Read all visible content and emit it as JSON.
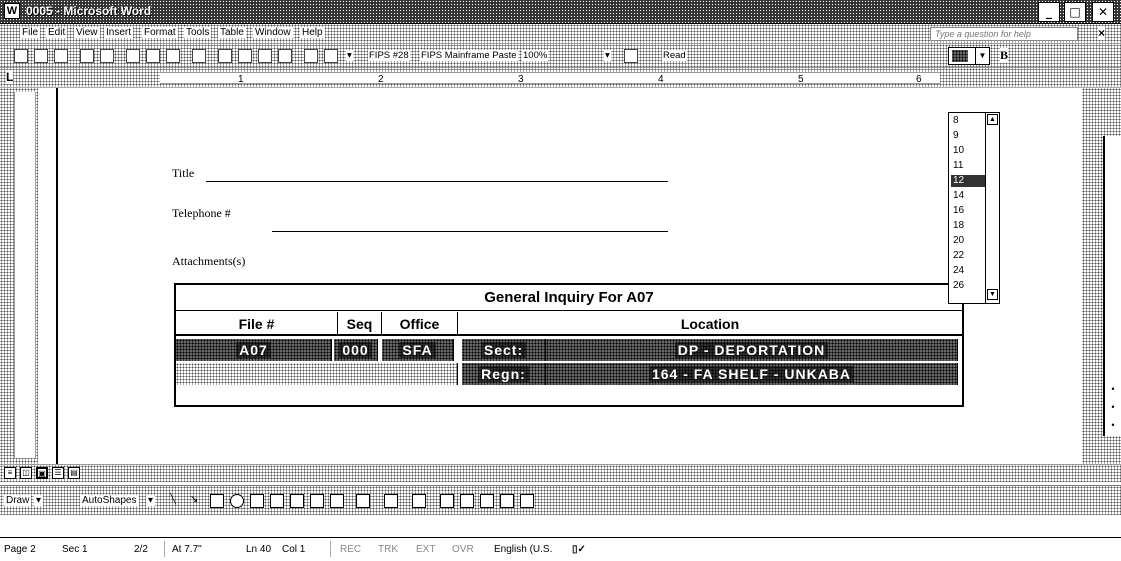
{
  "window": {
    "title": "0005 - Microsoft Word",
    "app_icon": "W"
  },
  "menu": {
    "items": [
      "File",
      "Edit",
      "View",
      "Insert",
      "Format",
      "Tools",
      "Table",
      "Window",
      "Help"
    ],
    "help_placeholder": "Type a question for help",
    "doc_close": "×"
  },
  "toolbar": {
    "style_name": "FIPS #28",
    "style2_name": "FIPS Mainframe Paste",
    "zoom": "100%",
    "read_label": "Read",
    "bold_label": "B"
  },
  "ruler": {
    "numbers": [
      "1",
      "2",
      "3",
      "4",
      "5",
      "6"
    ]
  },
  "document": {
    "title_label": "Title",
    "telephone_label": "Telephone #",
    "attachments_label": "Attachments(s)"
  },
  "table": {
    "title": "General Inquiry For A07",
    "headers": [
      "File #",
      "Seq",
      "Office",
      "Location"
    ],
    "row1": {
      "file": "A07",
      "seq": "000",
      "office": "SFA",
      "sect": "Sect:",
      "location": "DP - DEPORTATION"
    },
    "row2": {
      "regn": "Regn:",
      "location": "164 - FA SHELF - UNKABA"
    }
  },
  "font_size_dropdown": {
    "current": "",
    "options": [
      "8",
      "9",
      "10",
      "11",
      "12",
      "14",
      "16",
      "18",
      "20",
      "22",
      "24",
      "26"
    ],
    "selected_index": 4
  },
  "drawing_toolbar": {
    "draw_label": "Draw",
    "autoshapes_label": "AutoShapes"
  },
  "status": {
    "page": "Page 2",
    "sec": "Sec 1",
    "pages": "2/2",
    "at": "At 7.7\"",
    "ln": "Ln 40",
    "col": "Col 1",
    "rec": "REC",
    "trk": "TRK",
    "ext": "EXT",
    "ovr": "OVR",
    "language": "English (U.S."
  }
}
